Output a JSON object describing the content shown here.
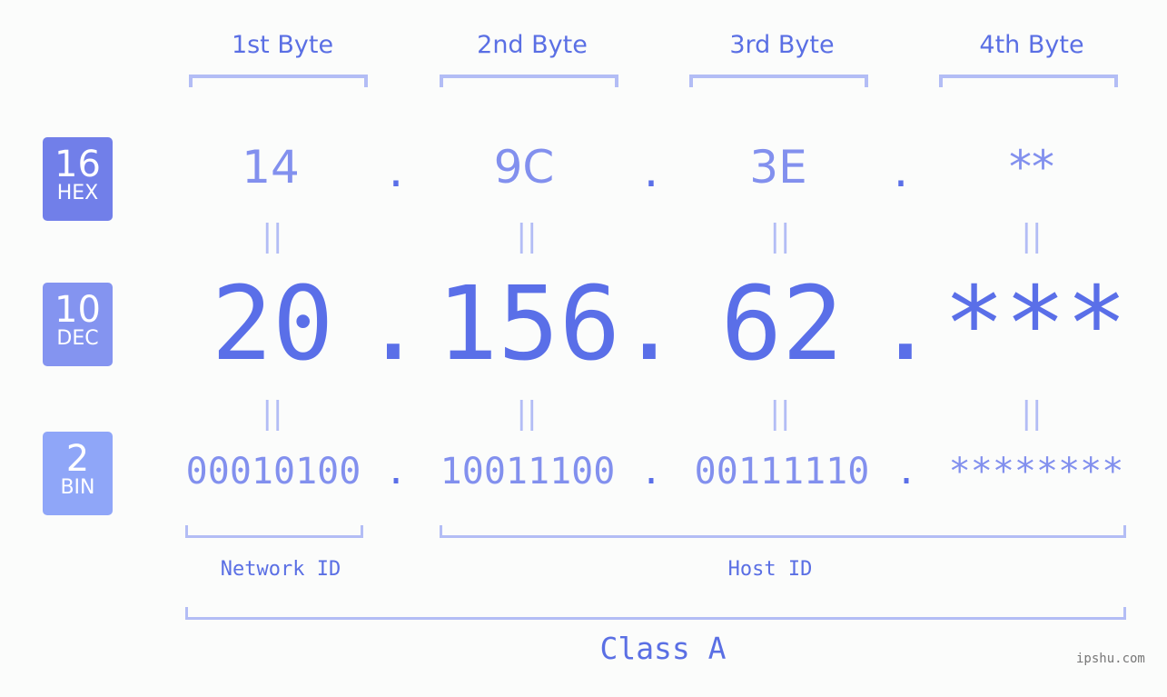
{
  "headers": [
    "1st Byte",
    "2nd Byte",
    "3rd Byte",
    "4th Byte"
  ],
  "badges": [
    {
      "num": "16",
      "label": "HEX",
      "color": "#717fe9"
    },
    {
      "num": "10",
      "label": "DEC",
      "color": "#8494f0"
    },
    {
      "num": "2",
      "label": "BIN",
      "color": "#8fa6f8"
    }
  ],
  "hex": [
    "14",
    "9C",
    "3E",
    "**"
  ],
  "dec": [
    "20",
    "156",
    "62",
    "***"
  ],
  "bin": [
    "00010100",
    "10011100",
    "00111110",
    "********"
  ],
  "separator": ".",
  "equals": "=",
  "network_label": "Network ID",
  "host_label": "Host ID",
  "class_label": "Class A",
  "watermark": "ipshu.com"
}
